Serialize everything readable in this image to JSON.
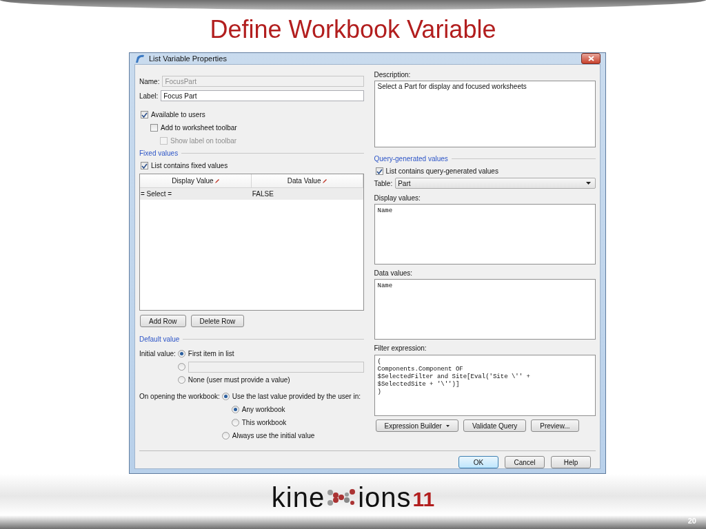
{
  "slide": {
    "title": "Define Workbook Variable",
    "page_number": "20"
  },
  "dialog": {
    "title": "List Variable Properties",
    "name_field": {
      "label": "Name:",
      "value": "FocusPart",
      "disabled": true
    },
    "label_field": {
      "label": "Label:",
      "value": "Focus Part",
      "disabled": false
    },
    "options": [
      {
        "label": "Available to users",
        "checked": true,
        "disabled": false,
        "children": [
          {
            "label": "Add to worksheet toolbar",
            "checked": false,
            "disabled": false,
            "children": [
              {
                "label": "Show label on toolbar",
                "checked": false,
                "disabled": true
              }
            ]
          }
        ]
      }
    ],
    "fixed_values": {
      "heading": "Fixed values",
      "checkbox": {
        "label": "List contains fixed values",
        "checked": true
      },
      "columns": [
        "Display Value",
        "Data Value"
      ],
      "rows": [
        {
          "cells": [
            "= Select =",
            "FALSE"
          ],
          "selected": true
        }
      ],
      "buttons": [
        "Add Row",
        "Delete Row"
      ]
    },
    "default_value": {
      "heading": "Default value",
      "initial_label": "Initial value:",
      "initial_options": [
        {
          "kind": "text",
          "label": "First item in list",
          "selected": true
        },
        {
          "kind": "field",
          "selected": false
        },
        {
          "kind": "text",
          "label": "None (user must provide a value)",
          "selected": false
        }
      ],
      "opening_label": "On opening the workbook:",
      "opening_options": [
        {
          "label": "Use the last value provided by the user in:",
          "selected": true,
          "children": [
            {
              "label": "Any workbook",
              "selected": true
            },
            {
              "label": "This workbook",
              "selected": false
            }
          ]
        },
        {
          "label": "Always use the initial value",
          "selected": false
        }
      ]
    },
    "description": {
      "label": "Description:",
      "value": "Select a Part for display and focused worksheets"
    },
    "query": {
      "heading": "Query-generated values",
      "checkbox": {
        "label": "List contains query-generated values",
        "checked": true
      },
      "table_label": "Table:",
      "table_value": "Part",
      "display_label": "Display values:",
      "display_value": "Name",
      "data_label": "Data values:",
      "data_value": "Name",
      "filter_label": "Filter expression:",
      "filter_lines": [
        "(",
        "Components.Component OF",
        "$SelectedFilter and Site[Eval('Site \\'' +",
        "$SelectedSite + '\\'')]",
        ")"
      ],
      "buttons": [
        {
          "label": "Expression Builder",
          "kind": "dropdown"
        },
        {
          "label": "Validate Query",
          "kind": "plain"
        },
        {
          "label": "Preview...",
          "kind": "plain"
        }
      ]
    },
    "footer_buttons": [
      {
        "label": "OK",
        "default": true
      },
      {
        "label": "Cancel",
        "default": false
      },
      {
        "label": "Help",
        "default": false
      }
    ]
  },
  "logo": {
    "text_before": "kine",
    "text_after": "ions",
    "edition": "11"
  }
}
